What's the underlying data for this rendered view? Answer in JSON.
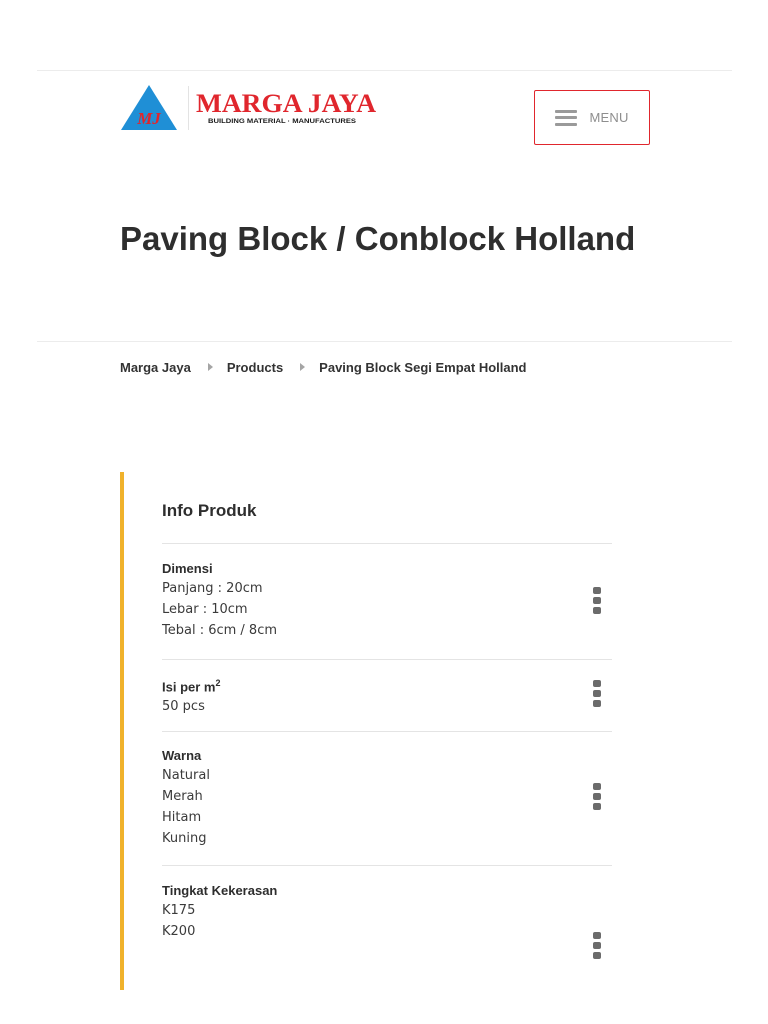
{
  "header": {
    "logo": {
      "monogram": "MJ",
      "brand": "MARGA JAYA",
      "tagline": "BUILDING MATERIAL · MANUFACTURES",
      "colors": {
        "brand_red": "#e0262d",
        "triangle_blue": "#1f8fd6",
        "monogram_red": "#e0262d"
      }
    },
    "menu_label": "MENU",
    "menu_icon": "hamburger-icon",
    "accent_border": "#e0262d"
  },
  "page_title": "Paving Block / Conblock Holland",
  "breadcrumb": [
    {
      "label": "Marga Jaya"
    },
    {
      "label": "Products"
    },
    {
      "label": "Paving Block Segi Empat Holland"
    }
  ],
  "breadcrumb_separator_icon": "caret-right-icon",
  "info": {
    "title": "Info Produk",
    "accent_color": "#f0b22c",
    "item_icon": "kebab-menu-icon",
    "items": [
      {
        "label": "Dimensi",
        "values": [
          "Panjang : 20cm",
          "Lebar : 10cm",
          "Tebal : 6cm / 8cm"
        ]
      },
      {
        "label": "Isi per m",
        "label_sup": "2",
        "values": [
          "50 pcs"
        ]
      },
      {
        "label": "Warna",
        "values": [
          "Natural",
          "Merah",
          "Hitam",
          "Kuning"
        ]
      },
      {
        "label": "Tingkat Kekerasan",
        "values": [
          "K175",
          "K200"
        ]
      }
    ]
  }
}
